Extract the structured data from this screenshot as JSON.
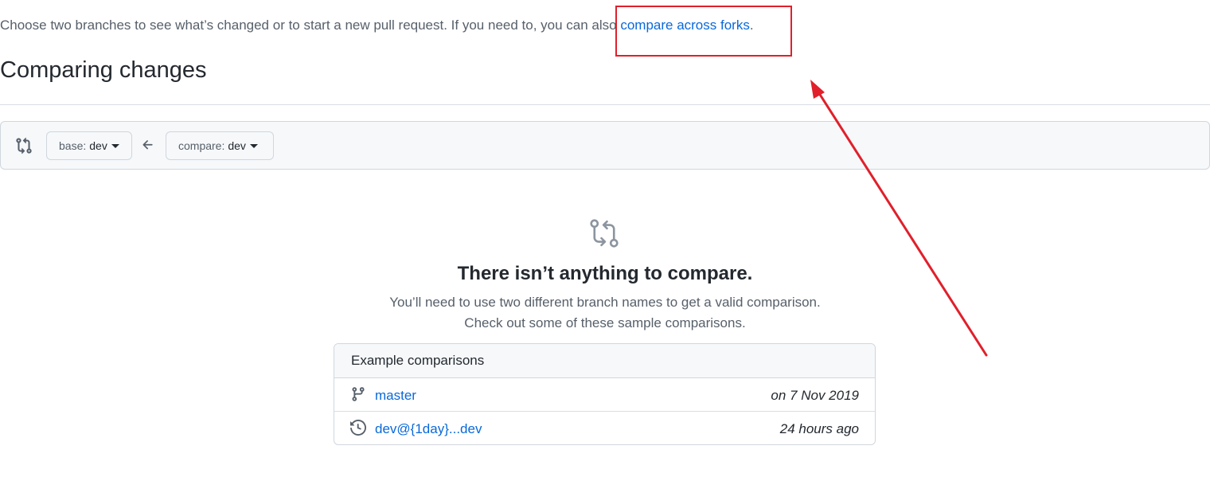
{
  "intro": {
    "text": "Choose two branches to see what’s changed or to start a new pull request. If you need to, you can also ",
    "link_label": "compare across forks",
    "suffix": "."
  },
  "page_title": "Comparing changes",
  "range": {
    "base_label": "base:",
    "base_value": "dev",
    "compare_label": "compare:",
    "compare_value": "dev",
    "icon": "git-compare-icon",
    "arrow_icon": "arrow-left-icon"
  },
  "blankslate": {
    "icon": "git-compare-icon",
    "title": "There isn’t anything to compare.",
    "description_line1": "You’ll need to use two different branch names to get a valid comparison.",
    "description_line2": "Check out some of these sample comparisons."
  },
  "examples": {
    "header": "Example comparisons",
    "rows": [
      {
        "icon": "git-branch-icon",
        "label": "master",
        "time": "on 7 Nov 2019"
      },
      {
        "icon": "history-icon",
        "label": "dev@{1day}...dev",
        "time": "24 hours ago"
      }
    ]
  },
  "colors": {
    "link": "#0969da",
    "muted": "#57606a",
    "annotation": "#e0202b"
  }
}
